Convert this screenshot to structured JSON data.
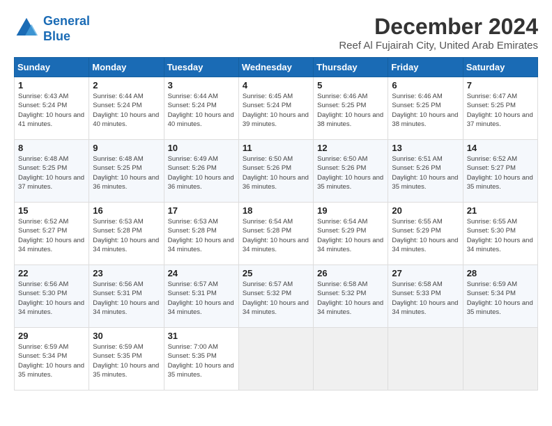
{
  "header": {
    "logo_line1": "General",
    "logo_line2": "Blue",
    "title": "December 2024",
    "subtitle": "Reef Al Fujairah City, United Arab Emirates"
  },
  "weekdays": [
    "Sunday",
    "Monday",
    "Tuesday",
    "Wednesday",
    "Thursday",
    "Friday",
    "Saturday"
  ],
  "weeks": [
    [
      {
        "day": 1,
        "sunrise": "6:43 AM",
        "sunset": "5:24 PM",
        "daylight": "10 hours and 41 minutes."
      },
      {
        "day": 2,
        "sunrise": "6:44 AM",
        "sunset": "5:24 PM",
        "daylight": "10 hours and 40 minutes."
      },
      {
        "day": 3,
        "sunrise": "6:44 AM",
        "sunset": "5:24 PM",
        "daylight": "10 hours and 40 minutes."
      },
      {
        "day": 4,
        "sunrise": "6:45 AM",
        "sunset": "5:24 PM",
        "daylight": "10 hours and 39 minutes."
      },
      {
        "day": 5,
        "sunrise": "6:46 AM",
        "sunset": "5:25 PM",
        "daylight": "10 hours and 38 minutes."
      },
      {
        "day": 6,
        "sunrise": "6:46 AM",
        "sunset": "5:25 PM",
        "daylight": "10 hours and 38 minutes."
      },
      {
        "day": 7,
        "sunrise": "6:47 AM",
        "sunset": "5:25 PM",
        "daylight": "10 hours and 37 minutes."
      }
    ],
    [
      {
        "day": 8,
        "sunrise": "6:48 AM",
        "sunset": "5:25 PM",
        "daylight": "10 hours and 37 minutes."
      },
      {
        "day": 9,
        "sunrise": "6:48 AM",
        "sunset": "5:25 PM",
        "daylight": "10 hours and 36 minutes."
      },
      {
        "day": 10,
        "sunrise": "6:49 AM",
        "sunset": "5:26 PM",
        "daylight": "10 hours and 36 minutes."
      },
      {
        "day": 11,
        "sunrise": "6:50 AM",
        "sunset": "5:26 PM",
        "daylight": "10 hours and 36 minutes."
      },
      {
        "day": 12,
        "sunrise": "6:50 AM",
        "sunset": "5:26 PM",
        "daylight": "10 hours and 35 minutes."
      },
      {
        "day": 13,
        "sunrise": "6:51 AM",
        "sunset": "5:26 PM",
        "daylight": "10 hours and 35 minutes."
      },
      {
        "day": 14,
        "sunrise": "6:52 AM",
        "sunset": "5:27 PM",
        "daylight": "10 hours and 35 minutes."
      }
    ],
    [
      {
        "day": 15,
        "sunrise": "6:52 AM",
        "sunset": "5:27 PM",
        "daylight": "10 hours and 34 minutes."
      },
      {
        "day": 16,
        "sunrise": "6:53 AM",
        "sunset": "5:28 PM",
        "daylight": "10 hours and 34 minutes."
      },
      {
        "day": 17,
        "sunrise": "6:53 AM",
        "sunset": "5:28 PM",
        "daylight": "10 hours and 34 minutes."
      },
      {
        "day": 18,
        "sunrise": "6:54 AM",
        "sunset": "5:28 PM",
        "daylight": "10 hours and 34 minutes."
      },
      {
        "day": 19,
        "sunrise": "6:54 AM",
        "sunset": "5:29 PM",
        "daylight": "10 hours and 34 minutes."
      },
      {
        "day": 20,
        "sunrise": "6:55 AM",
        "sunset": "5:29 PM",
        "daylight": "10 hours and 34 minutes."
      },
      {
        "day": 21,
        "sunrise": "6:55 AM",
        "sunset": "5:30 PM",
        "daylight": "10 hours and 34 minutes."
      }
    ],
    [
      {
        "day": 22,
        "sunrise": "6:56 AM",
        "sunset": "5:30 PM",
        "daylight": "10 hours and 34 minutes."
      },
      {
        "day": 23,
        "sunrise": "6:56 AM",
        "sunset": "5:31 PM",
        "daylight": "10 hours and 34 minutes."
      },
      {
        "day": 24,
        "sunrise": "6:57 AM",
        "sunset": "5:31 PM",
        "daylight": "10 hours and 34 minutes."
      },
      {
        "day": 25,
        "sunrise": "6:57 AM",
        "sunset": "5:32 PM",
        "daylight": "10 hours and 34 minutes."
      },
      {
        "day": 26,
        "sunrise": "6:58 AM",
        "sunset": "5:32 PM",
        "daylight": "10 hours and 34 minutes."
      },
      {
        "day": 27,
        "sunrise": "6:58 AM",
        "sunset": "5:33 PM",
        "daylight": "10 hours and 34 minutes."
      },
      {
        "day": 28,
        "sunrise": "6:59 AM",
        "sunset": "5:34 PM",
        "daylight": "10 hours and 35 minutes."
      }
    ],
    [
      {
        "day": 29,
        "sunrise": "6:59 AM",
        "sunset": "5:34 PM",
        "daylight": "10 hours and 35 minutes."
      },
      {
        "day": 30,
        "sunrise": "6:59 AM",
        "sunset": "5:35 PM",
        "daylight": "10 hours and 35 minutes."
      },
      {
        "day": 31,
        "sunrise": "7:00 AM",
        "sunset": "5:35 PM",
        "daylight": "10 hours and 35 minutes."
      },
      null,
      null,
      null,
      null
    ]
  ]
}
